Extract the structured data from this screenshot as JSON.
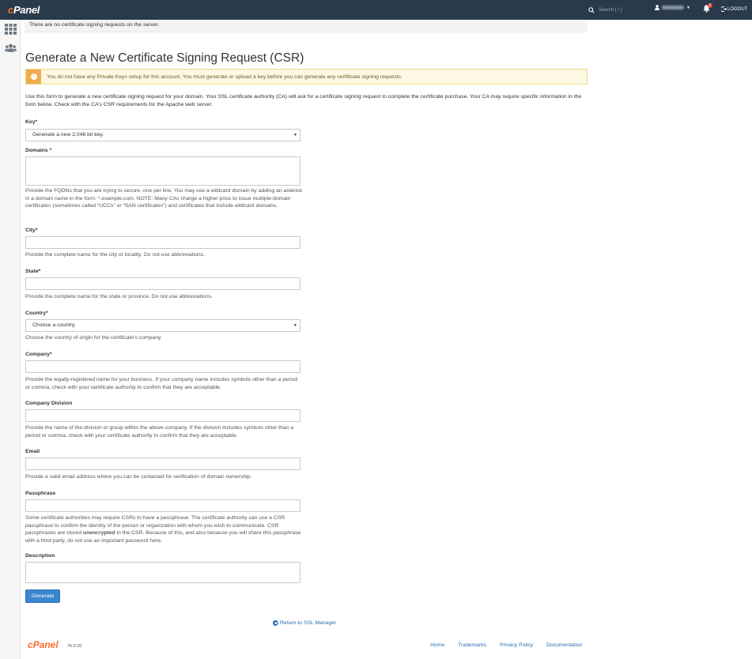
{
  "header": {
    "logo": "cPanel",
    "search_placeholder": "Search ( / )",
    "notification_count": "2",
    "logout_label": "LOGOUT"
  },
  "notice_top": "There are no certificate signing requests on the server.",
  "page": {
    "title": "Generate a New Certificate Signing Request (CSR)",
    "alert": "You do not have any Private Keys setup for this account. You must generate or upload a key before you can generate any certificate signing requests.",
    "intro": "Use this form to generate a new certificate signing request for your domain. Your SSL certificate authority (CA) will ask for a certificate signing request to complete the certificate purchase. Your CA may require specific information in the form below. Check with the CA’s CSR requirements for the Apache web server."
  },
  "form": {
    "key": {
      "label": "Key*",
      "selected": "Generate a new 2,048 bit key."
    },
    "domains": {
      "label": "Domains *",
      "help": "Provide the FQDNs that you are trying to secure, one per line. You may use a wildcard domain by adding an asterisk in a domain name in the form: *.example.com. NOTE: Many CAs charge a higher price to issue multiple-domain certificates (sometimes called “UCCs” or “SAN certificates”) and certificates that include wildcard domains."
    },
    "city": {
      "label": "City*",
      "help": "Provide the complete name for the city or locality. Do not use abbreviations."
    },
    "state": {
      "label": "State*",
      "help": "Provide the complete name for the state or province. Do not use abbreviations."
    },
    "country": {
      "label": "Country*",
      "selected": "Choose a country.",
      "help": "Choose the country of origin for the certificate’s company."
    },
    "company": {
      "label": "Company*",
      "help": "Provide the legally-registered name for your business. If your company name includes symbols other than a period or comma, check with your certificate authority to confirm that they are acceptable."
    },
    "division": {
      "label": "Company Division",
      "help": "Provide the name of the division or group within the above company. If the division includes symbols other than a period or comma, check with your certificate authority to confirm that they are acceptable."
    },
    "email": {
      "label": "Email",
      "help": "Provide a valid email address where you can be contacted for verification of domain ownership."
    },
    "passphrase": {
      "label": "Passphrase",
      "help_pre": "Some certificate authorities may require CSRs to have a passphrase. The certificate authority can use a CSR passphrase to confirm the identity of the person or organization with whom you wish to communicate. CSR passphrases are stored ",
      "help_bold": "unencrypted",
      "help_post": " in the CSR. Because of this, and also because you will share this passphrase with a third party, do not use an important password here."
    },
    "description": {
      "label": "Description"
    },
    "generate_label": "Generate"
  },
  "return_link": "Return to SSL Manager",
  "footer": {
    "logo": "cPanel",
    "version": "76.0.20",
    "links": [
      "Home",
      "Trademarks",
      "Privacy Policy",
      "Documentation"
    ]
  },
  "colors": {
    "topbar": "#293a4a",
    "brand_orange": "#ff6c2c",
    "primary_button": "#3b87d1",
    "alert_bg": "#fcf8e3",
    "link": "#2a6db0"
  }
}
